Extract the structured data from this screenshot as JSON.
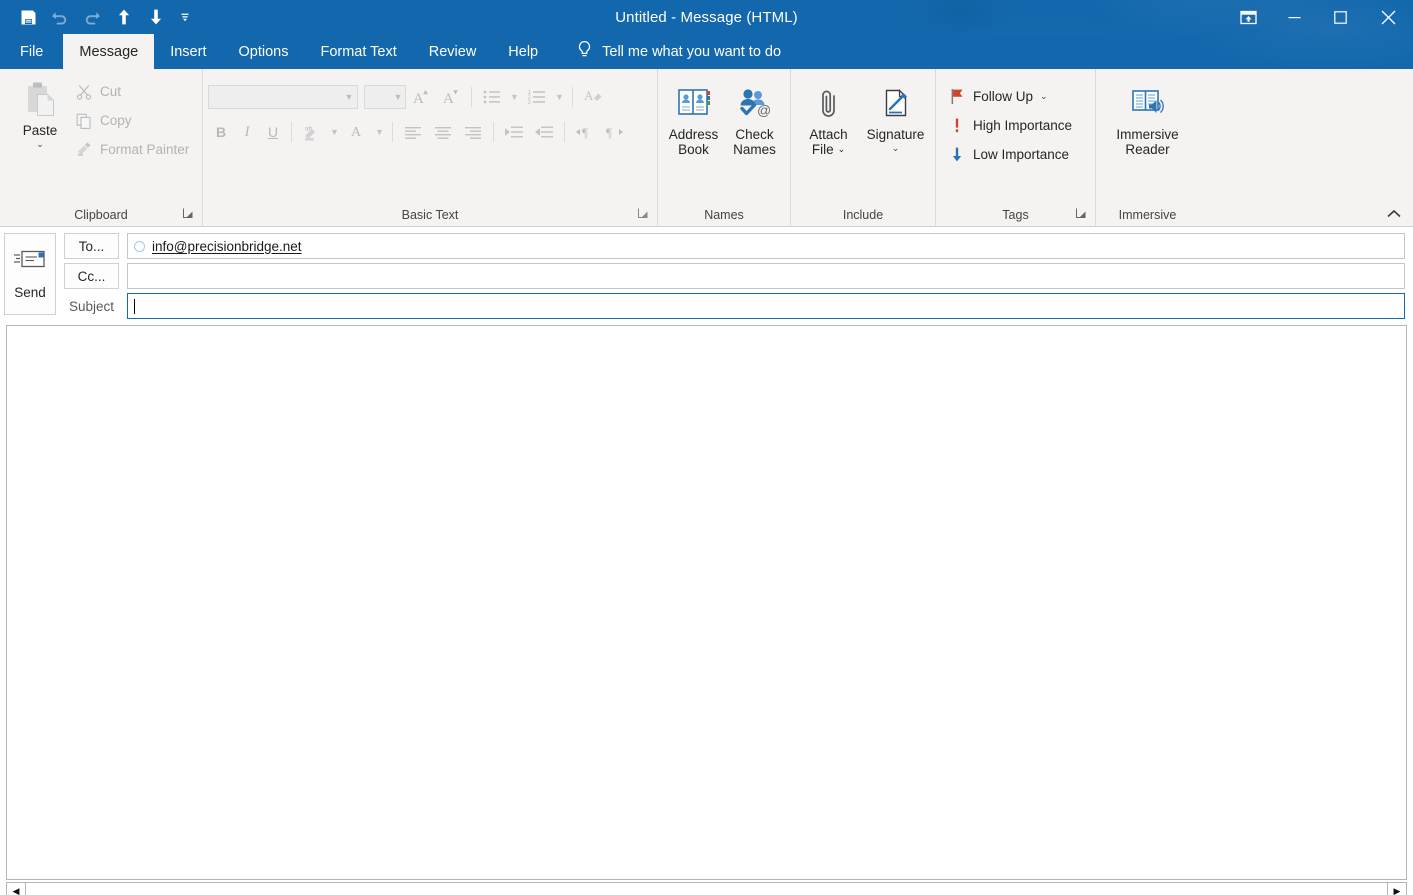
{
  "window": {
    "title": "Untitled  -  Message (HTML)",
    "accent_color": "#1368ad",
    "ribbon_bg": "#f4f3f2"
  },
  "quick_access": {
    "items": [
      {
        "name": "save-icon",
        "label": "Save",
        "disabled": false
      },
      {
        "name": "undo-icon",
        "label": "Undo",
        "disabled": true
      },
      {
        "name": "redo-icon",
        "label": "Redo",
        "disabled": true
      },
      {
        "name": "previous-item-icon",
        "label": "Previous Item",
        "disabled": false
      },
      {
        "name": "next-item-icon",
        "label": "Next Item",
        "disabled": false
      },
      {
        "name": "customize-qat-icon",
        "label": "Customize Quick Access Toolbar",
        "disabled": false
      }
    ]
  },
  "window_controls": {
    "ribbon_display": "Ribbon Display Options",
    "minimize": "Minimize",
    "maximize": "Maximize",
    "close": "Close"
  },
  "tabs": [
    {
      "label": "File",
      "active": false
    },
    {
      "label": "Message",
      "active": true
    },
    {
      "label": "Insert",
      "active": false
    },
    {
      "label": "Options",
      "active": false
    },
    {
      "label": "Format Text",
      "active": false
    },
    {
      "label": "Review",
      "active": false
    },
    {
      "label": "Help",
      "active": false
    }
  ],
  "tell_me": {
    "label": "Tell me what you want to do",
    "icon": "lightbulb-icon"
  },
  "ribbon": {
    "clipboard": {
      "group_label": "Clipboard",
      "paste": {
        "label": "Paste",
        "caret": "⌄"
      },
      "items": [
        {
          "label": "Cut",
          "icon": "scissors-icon",
          "disabled": true
        },
        {
          "label": "Copy",
          "icon": "copy-icon",
          "disabled": true
        },
        {
          "label": "Format Painter",
          "icon": "format-painter-icon",
          "disabled": true
        }
      ]
    },
    "basic_text": {
      "group_label": "Basic Text",
      "font_name": "",
      "font_size": "",
      "buttons": [
        "bold",
        "italic",
        "underline",
        "text-highlight",
        "font-color",
        "grow-font",
        "shrink-font",
        "bullets",
        "numbering",
        "clear-formatting",
        "align-left",
        "align-center",
        "align-right",
        "decrease-indent",
        "increase-indent",
        "ltr-text-direction",
        "rtl-text-direction"
      ],
      "disabled": true
    },
    "names": {
      "group_label": "Names",
      "items": [
        {
          "label_line1": "Address",
          "label_line2": "Book",
          "icon": "address-book-icon"
        },
        {
          "label_line1": "Check",
          "label_line2": "Names",
          "icon": "check-names-icon"
        }
      ]
    },
    "include": {
      "group_label": "Include",
      "items": [
        {
          "label_line1": "Attach",
          "label_line2": "File",
          "icon": "paperclip-icon",
          "caret": "⌄"
        },
        {
          "label_line1": "Signature",
          "label_line2": "",
          "icon": "signature-icon",
          "caret": "⌄"
        }
      ]
    },
    "tags": {
      "group_label": "Tags",
      "items": [
        {
          "label": "Follow Up",
          "icon": "flag-icon",
          "caret": "⌄",
          "color": "#d0422a"
        },
        {
          "label": "High Importance",
          "icon": "exclamation-icon",
          "caret": "",
          "color": "#d0422a"
        },
        {
          "label": "Low Importance",
          "icon": "down-arrow-icon",
          "caret": "",
          "color": "#2e74b5"
        }
      ]
    },
    "immersive": {
      "group_label": "Immersive",
      "item": {
        "label_line1": "Immersive",
        "label_line2": "Reader",
        "icon": "immersive-reader-icon"
      }
    },
    "collapse_label": "Collapse the Ribbon"
  },
  "compose": {
    "send_label": "Send",
    "to_label": "To...",
    "cc_label": "Cc...",
    "subject_label": "Subject",
    "to_value": "info@precisionbridge.net",
    "cc_value": "",
    "subject_value": "",
    "body_value": ""
  },
  "scrollbar": {
    "left_arrow": "◀",
    "right_arrow": "▶"
  }
}
